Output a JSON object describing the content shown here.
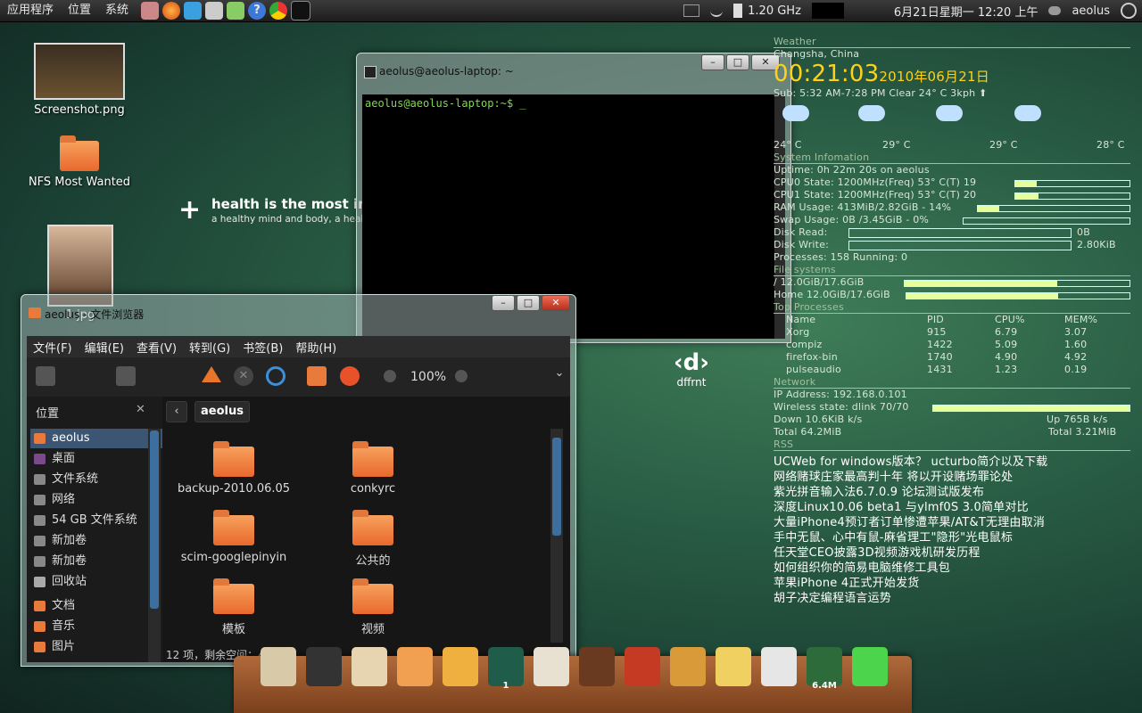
{
  "top_panel": {
    "menus": [
      "应用程序",
      "位置",
      "系统"
    ],
    "cpu_freq": "1.20 GHz",
    "datetime": "6月21日星期一 12:20 上午",
    "user": "aeolus"
  },
  "desktop": {
    "icons": [
      {
        "label": "Screenshot.png"
      },
      {
        "label": "NFS Most Wanted"
      },
      {
        "label": "1.jpg"
      }
    ],
    "slogan": {
      "title": "health is the most important wealth",
      "subtitle": "a healthy mind and body, a healthy family, a healthy environment, a healthy tomorrow... let's work towards them."
    },
    "dffrnt": {
      "logo": "‹d›",
      "label": "dffrnt"
    }
  },
  "terminal": {
    "title": "aeolus@aeolus-laptop: ~",
    "prompt": "aeolus@aeolus-laptop:~$ _"
  },
  "file_browser": {
    "title": "aeolus - 文件浏览器",
    "menu": [
      "文件(F)",
      "编辑(E)",
      "查看(V)",
      "转到(G)",
      "书签(B)",
      "帮助(H)"
    ],
    "zoom": "100%",
    "sidebar_title": "位置",
    "breadcrumb": "aeolus",
    "sidebar": [
      {
        "label": "aeolus",
        "color": "#e87a3c",
        "selected": true
      },
      {
        "label": "桌面",
        "color": "#7b4a8a"
      },
      {
        "label": "文件系统",
        "color": "#888888"
      },
      {
        "label": "网络",
        "color": "#888888"
      },
      {
        "label": "54 GB 文件系统",
        "color": "#888888"
      },
      {
        "label": "新加卷",
        "color": "#888888"
      },
      {
        "label": "新加卷",
        "color": "#888888"
      },
      {
        "label": "回收站",
        "color": "#aaaaaa"
      },
      {
        "label": "文档",
        "color": "#e87a3c"
      },
      {
        "label": "音乐",
        "color": "#e87a3c"
      },
      {
        "label": "图片",
        "color": "#e87a3c"
      }
    ],
    "files": [
      {
        "name": "backup-2010.06.05"
      },
      {
        "name": "conkyrc"
      },
      {
        "name": "scim-googlepinyin"
      },
      {
        "name": "公共的"
      },
      {
        "name": "模板"
      },
      {
        "name": "视频"
      }
    ],
    "status": "12 项，剩余空间：4.7 GB"
  },
  "conky": {
    "weather_head": "Weather",
    "location": "Changsha, China",
    "time": "00:21:03",
    "date": "2010年06月21日",
    "sun": "Sub: 5:32 AM-7:28 PM   Clear   24° C   3kph ⬆",
    "temps": [
      "24° C",
      "29° C",
      "29° C",
      "28° C"
    ],
    "sys_head": "System Infomation",
    "uptime": "Uptime: 0h 22m 20s   on aeolus",
    "cpu0": "CPU0 State: 1200MHz(Freq) 53° C(T) 19",
    "cpu1": "CPU1 State: 1200MHz(Freq) 53° C(T) 20",
    "ram": "RAM Usage: 413MiB/2.82GiB - 14%",
    "swap": "Swap Usage: 0B   /3.45GiB - 0%",
    "disk_read": "Disk Read:",
    "disk_read_val": "0B",
    "disk_write": "Disk Write:",
    "disk_write_val": "2.80KiB",
    "processes": "Processes: 158   Running: 0",
    "fs_head": "File systems",
    "fs_root": "/ 12.0GiB/17.6GiB",
    "fs_home": "Home 12.0GiB/17.6GiB",
    "top_head": "Top Processes",
    "top_cols": [
      "Name",
      "PID",
      "CPU%",
      "MEM%"
    ],
    "top_rows": [
      [
        "Xorg",
        "915",
        "6.79",
        "3.07"
      ],
      [
        "compiz",
        "1422",
        "5.09",
        "1.60"
      ],
      [
        "firefox-bin",
        "1740",
        "4.90",
        "4.92"
      ],
      [
        "pulseaudio",
        "1431",
        "1.23",
        "0.19"
      ]
    ],
    "net_head": "Network",
    "ip": "IP Address: 192.168.0.101",
    "wireless": "Wireless state: dlink 70/70",
    "down": "Down 10.6KiB k/s",
    "up": "Up 765B   k/s",
    "total_down": "Total  64.2MiB",
    "total_up": "Total  3.21MiB",
    "rss_head": "RSS",
    "rss": [
      "UCWeb for windows版本？ ucturbo简介以及下载",
      "网络赌球庄家最高判十年 将以开设赌场罪论处",
      "紫光拼音输入法6.7.0.9 论坛测试版发布",
      "深度Linux10.06 beta1 与ylmf0S 3.0简单对比",
      "大量iPhone4预订者订单惨遭苹果/AT&T无理由取消",
      "手中无鼠、心中有鼠-麻省理工\"隐形\"光电鼠标",
      "任天堂CEO披露3D视频游戏机研发历程",
      "如何组织你的简易电脑维修工具包",
      "苹果iPhone 4正式开始发货",
      "胡子决定编程语言运势"
    ],
    "bars": {
      "cpu0": 0.19,
      "cpu1": 0.2,
      "ram": 0.14,
      "swap": 0.0,
      "fs_root": 0.68,
      "fs_home": 0.68,
      "wireless": 1.0
    }
  },
  "dock": {
    "items": [
      {
        "name": "dock-app-1",
        "color": "#d8c9a8"
      },
      {
        "name": "dock-pen",
        "color": "#333333"
      },
      {
        "name": "dock-scroll",
        "color": "#e6d5b0"
      },
      {
        "name": "dock-files",
        "color": "#f0a050"
      },
      {
        "name": "dock-app-yu",
        "color": "#f0b040"
      },
      {
        "name": "dock-workspace",
        "color": "#1f5c4a",
        "label": "1"
      },
      {
        "name": "dock-torii-screen",
        "color": "#e8e0d0"
      },
      {
        "name": "dock-abacus",
        "color": "#6a3a20"
      },
      {
        "name": "dock-torii",
        "color": "#c43a22"
      },
      {
        "name": "dock-lanterns",
        "color": "#d99a3a"
      },
      {
        "name": "dock-weather",
        "color": "#f0d060"
      },
      {
        "name": "dock-brush",
        "color": "#e6e6e6"
      },
      {
        "name": "dock-memory",
        "color": "#2d6b3a",
        "label": "6.4M"
      },
      {
        "name": "dock-battery",
        "color": "#4cd44c"
      }
    ]
  }
}
